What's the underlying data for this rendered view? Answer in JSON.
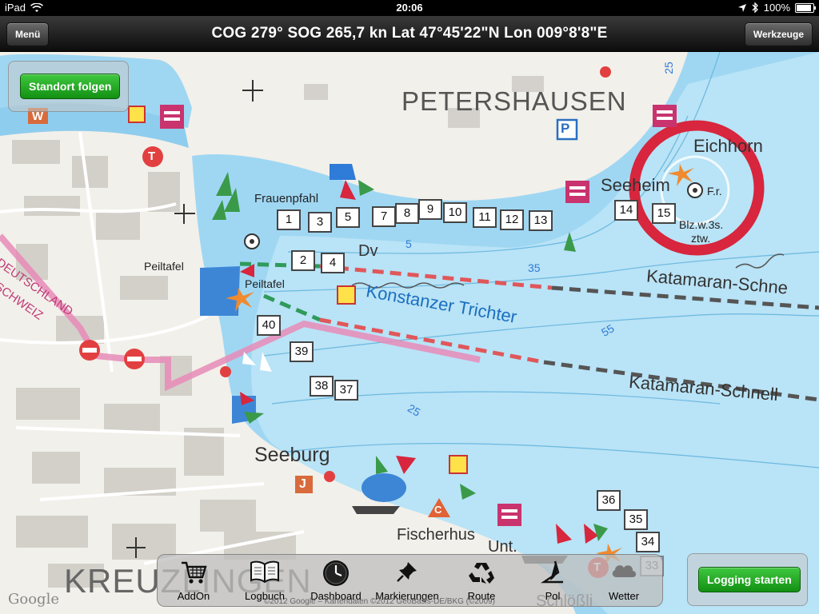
{
  "status": {
    "device": "iPad",
    "time": "20:06",
    "battery": "100%",
    "battery_fraction": 1.0
  },
  "nav": {
    "menu_label": "Menü",
    "title": "COG 279°  SOG 265,7 kn  Lat 47°45'22\"N  Lon 009°8'8\"E",
    "tools_label": "Werkzeuge"
  },
  "map": {
    "places": {
      "petershausen": "PETERSHAUSEN",
      "eichhorn": "Eichhorn",
      "seeheim": "Seeheim",
      "frauenpfahl": "Frauenpfahl",
      "peiltafel1": "Peiltafel",
      "peiltafel2": "Peiltafel",
      "konstanzer": "Konstanzer Trichter",
      "katamaran1": "Katamaran-Schne",
      "katamaran2": "Katamaran-Schnell",
      "seeburg": "Seeburg",
      "fischerhus": "Fischerhus",
      "unt": "Unt.",
      "schloessli": "Schlößli",
      "kreuzlingen": "KREUZLINGEN",
      "deutschland": "DEUTSCHLAND",
      "schweiz": "SCHWEIZ",
      "dv": "Dv",
      "fr": "F.r.",
      "blz": "Blz.w.3s.",
      "ztw": "ztw."
    },
    "depths": [
      "25",
      "5",
      "35",
      "55",
      "25"
    ],
    "buoys": [
      "1",
      "3",
      "5",
      "7",
      "8",
      "9",
      "10",
      "11",
      "12",
      "13",
      "14",
      "15",
      "2",
      "4",
      "40",
      "39",
      "38",
      "37",
      "36",
      "35",
      "34",
      "33"
    ],
    "sign_labels": {
      "p": "P",
      "w": "W",
      "j": "J",
      "c": "C",
      "t": "T"
    },
    "google": "Google",
    "copyright": "©2012 Google – Kartendaten ©2012 GeoBasis-DE/BKG (©2009)"
  },
  "buttons": {
    "follow_location": "Standort folgen",
    "start_logging": "Logging starten"
  },
  "toolbar": [
    {
      "label": "AddOn",
      "icon": "cart-icon"
    },
    {
      "label": "Logbuch",
      "icon": "book-icon"
    },
    {
      "label": "Dashboard",
      "icon": "clock-icon"
    },
    {
      "label": "Markierungen",
      "icon": "pin-icon"
    },
    {
      "label": "Route",
      "icon": "recycle-icon"
    },
    {
      "label": "Pol",
      "icon": "polar-icon"
    },
    {
      "label": "Wetter",
      "icon": "weather-icon"
    }
  ],
  "colors": {
    "water": "#9fd7f3",
    "land": "#f2f0ea",
    "green_button": "#1fa21f",
    "zone_red": "#d7263d"
  }
}
